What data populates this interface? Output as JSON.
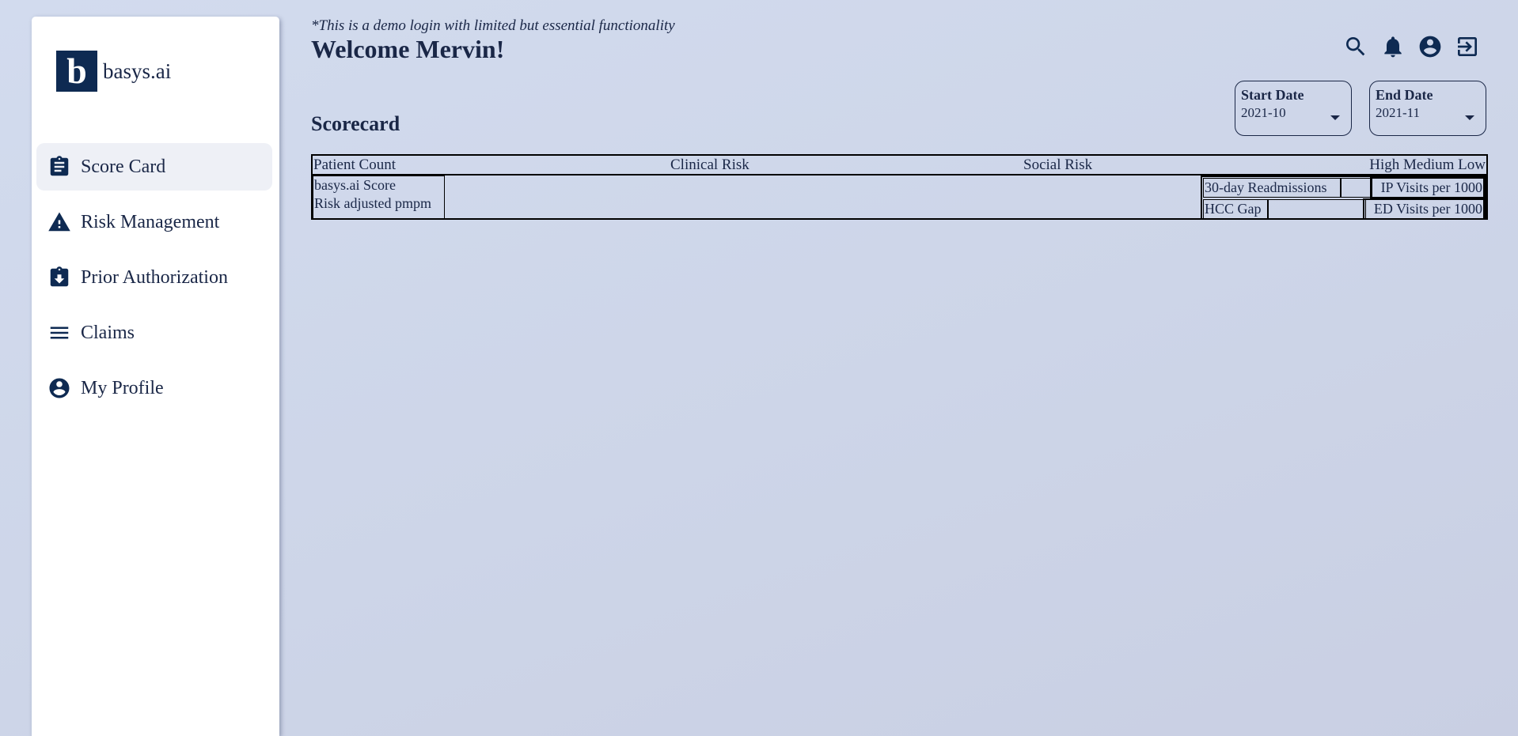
{
  "brand": {
    "logo_letter": "b",
    "name": "basys.ai"
  },
  "sidebar": {
    "items": [
      {
        "label": "Score Card",
        "icon": "clipboard-icon",
        "active": true
      },
      {
        "label": "Risk Management",
        "icon": "warning-icon",
        "active": false
      },
      {
        "label": "Prior Authorization",
        "icon": "clipboard-download-icon",
        "active": false
      },
      {
        "label": "Claims",
        "icon": "menu-lines-icon",
        "active": false
      },
      {
        "label": "My Profile",
        "icon": "account-circle-icon",
        "active": false
      }
    ]
  },
  "header": {
    "demo_note": "*This is a demo login with limited but essential functionality",
    "welcome": "Welcome Mervin!",
    "icons": [
      "search-icon",
      "bell-icon",
      "account-circle-icon",
      "logout-icon"
    ]
  },
  "filters": {
    "start": {
      "label": "Start Date",
      "value": "2021-10"
    },
    "end": {
      "label": "End Date",
      "value": "2021-11"
    }
  },
  "scorecard": {
    "title": "Scorecard",
    "headers": {
      "patient_count": "Patient Count",
      "clinical_risk": "Clinical Risk",
      "social_risk": "Social Risk",
      "levels": "High Medium Low"
    },
    "left_cells": [
      "basys.ai Score",
      "Risk adjusted pmpm"
    ],
    "right_cells": {
      "readmissions": "30-day Readmissions",
      "ip_visits": "IP Visits per 1000",
      "hcc_gap": "HCC Gap",
      "ed_visits": "ED Visits per 1000"
    }
  },
  "colors": {
    "primary": "#0e2a52",
    "background": "#cfd7ea",
    "active_nav": "#eef0f6"
  }
}
